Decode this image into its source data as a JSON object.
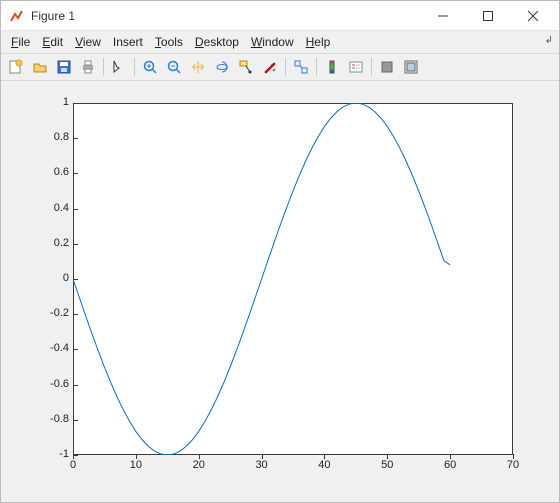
{
  "window": {
    "title": "Figure 1"
  },
  "menu": {
    "file": "File",
    "edit": "Edit",
    "view": "View",
    "insert": "Insert",
    "tools": "Tools",
    "desktop": "Desktop",
    "window": "Window",
    "help": "Help"
  },
  "toolbar_icons": {
    "new": "new-figure-icon",
    "open": "open-icon",
    "save": "save-icon",
    "print": "print-icon",
    "pointer": "pointer-icon",
    "zoomin": "zoom-in-icon",
    "zoomout": "zoom-out-icon",
    "pan": "pan-icon",
    "rotate": "rotate-3d-icon",
    "datacursor": "data-cursor-icon",
    "brush": "brush-icon",
    "link": "link-icon",
    "colorbar": "colorbar-icon",
    "legend": "legend-icon",
    "hide": "hide-plot-tools-icon",
    "show": "show-plot-tools-icon"
  },
  "chart_data": {
    "type": "line",
    "xlim": [
      0,
      70
    ],
    "ylim": [
      -1,
      1
    ],
    "xticks": [
      0,
      10,
      20,
      30,
      40,
      50,
      60,
      70
    ],
    "yticks": [
      -1,
      -0.8,
      -0.6,
      -0.4,
      -0.2,
      0,
      0.2,
      0.4,
      0.6,
      0.8,
      1
    ],
    "x": [
      0,
      1,
      2,
      3,
      4,
      5,
      6,
      7,
      8,
      9,
      10,
      11,
      12,
      13,
      14,
      15,
      16,
      17,
      18,
      19,
      20,
      21,
      22,
      23,
      24,
      25,
      26,
      27,
      28,
      29,
      30,
      31,
      32,
      33,
      34,
      35,
      36,
      37,
      38,
      39,
      40,
      41,
      42,
      43,
      44,
      45,
      46,
      47,
      48,
      49,
      50,
      51,
      52,
      53,
      54,
      55,
      56,
      57,
      58,
      59,
      60
    ],
    "y": [
      0,
      -0.1045,
      -0.2079,
      -0.309,
      -0.4067,
      -0.5,
      -0.5878,
      -0.6691,
      -0.7431,
      -0.809,
      -0.866,
      -0.9135,
      -0.9511,
      -0.9781,
      -0.9945,
      -1,
      -0.9945,
      -0.9781,
      -0.9511,
      -0.9135,
      -0.866,
      -0.809,
      -0.7431,
      -0.6691,
      -0.5878,
      -0.5,
      -0.4067,
      -0.309,
      -0.2079,
      -0.1045,
      0,
      0.1045,
      0.2079,
      0.309,
      0.4067,
      0.5,
      0.5878,
      0.6691,
      0.7431,
      0.809,
      0.866,
      0.9135,
      0.9511,
      0.9781,
      0.9945,
      1,
      0.9945,
      0.9781,
      0.9511,
      0.9135,
      0.866,
      0.809,
      0.7431,
      0.6691,
      0.5878,
      0.5,
      0.4067,
      0.309,
      0.2079,
      0.1045,
      0.08
    ],
    "title": "",
    "xlabel": "",
    "ylabel": "",
    "line_color": "#0072bd",
    "grid": false
  }
}
